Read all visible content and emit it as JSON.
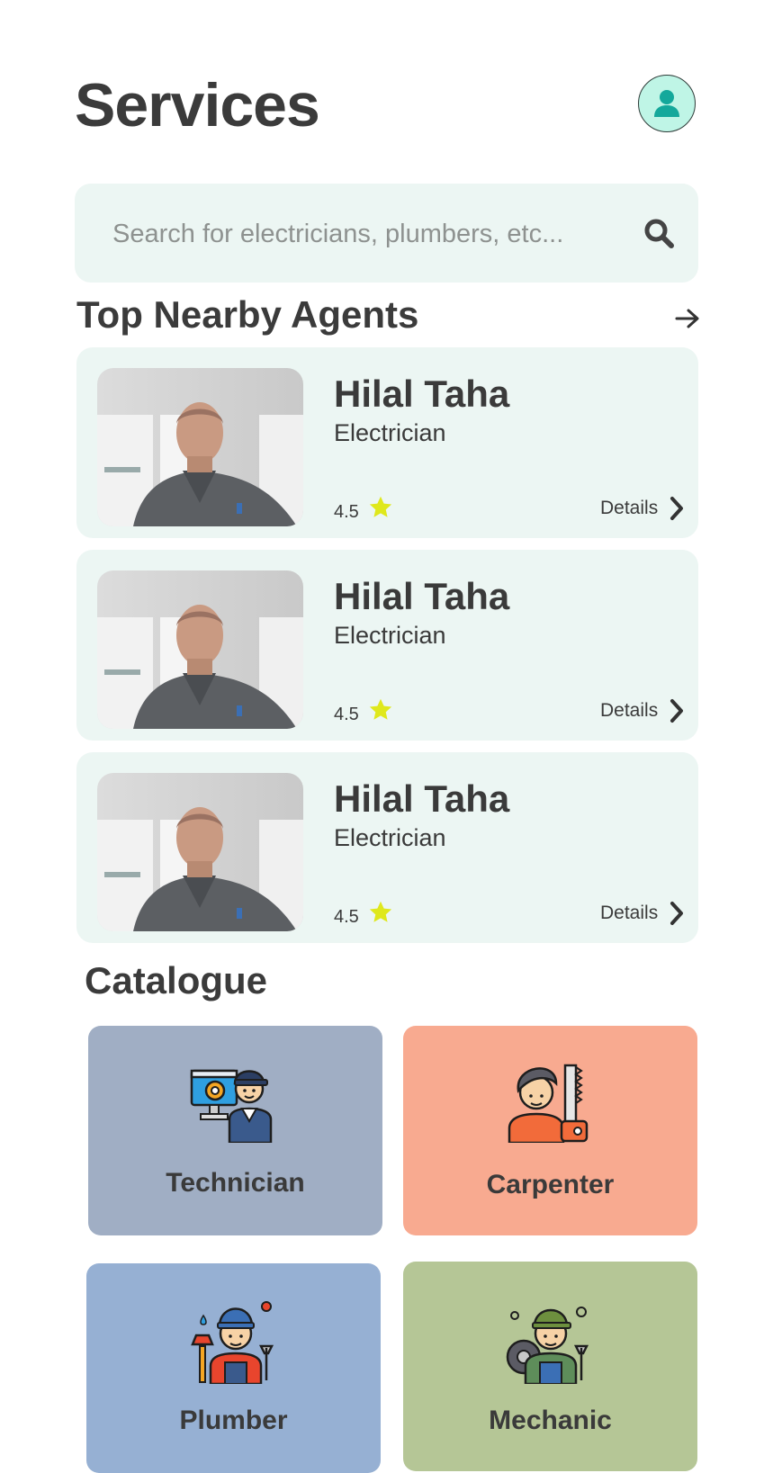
{
  "header": {
    "title": "Services",
    "avatar_icon": "user-icon"
  },
  "search": {
    "placeholder": "Search for electricians, plumbers, etc...",
    "value": "",
    "icon": "search-icon"
  },
  "agents_section": {
    "title": "Top Nearby Agents",
    "arrow_icon": "arrow-right-icon",
    "agents": [
      {
        "name": "Hilal Taha",
        "role": "Electrician",
        "rating": "4.5",
        "details_label": "Details"
      },
      {
        "name": "Hilal Taha",
        "role": "Electrician",
        "rating": "4.5",
        "details_label": "Details"
      },
      {
        "name": "Hilal Taha",
        "role": "Electrician",
        "rating": "4.5",
        "details_label": "Details"
      }
    ]
  },
  "catalogue": {
    "title": "Catalogue",
    "items": [
      {
        "label": "Technician",
        "icon": "technician-icon",
        "color": "#a0aec4"
      },
      {
        "label": "Carpenter",
        "icon": "carpenter-icon",
        "color": "#f8aa90"
      },
      {
        "label": "Plumber",
        "icon": "plumber-icon",
        "color": "#96b0d3"
      },
      {
        "label": "Mechanic",
        "icon": "mechanic-icon",
        "color": "#b5c696"
      }
    ]
  },
  "colors": {
    "card_bg": "#ecf6f3",
    "avatar_bg": "#bff5e6",
    "avatar_icon": "#1aa79a",
    "star": "#dfe81c",
    "text": "#3a3a3a"
  }
}
